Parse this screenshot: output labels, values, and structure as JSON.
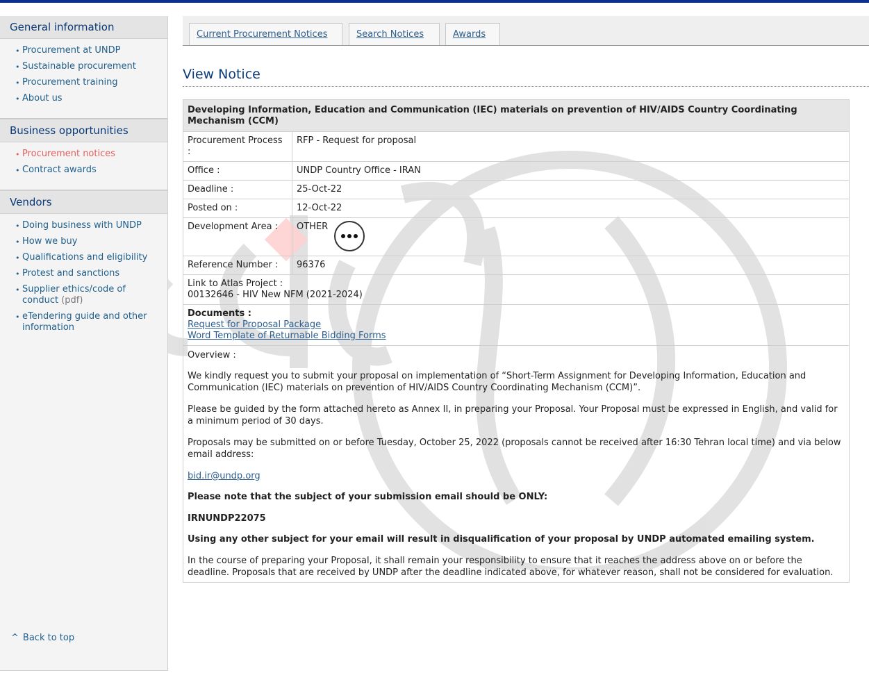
{
  "sidebar": {
    "sections": [
      {
        "title": "General information",
        "items": [
          {
            "label": "Procurement at UNDP"
          },
          {
            "label": "Sustainable procurement"
          },
          {
            "label": "Procurement training"
          },
          {
            "label": "About us"
          }
        ]
      },
      {
        "title": "Business opportunities",
        "items": [
          {
            "label": "Procurement notices",
            "active": true
          },
          {
            "label": "Contract awards"
          }
        ]
      },
      {
        "title": "Vendors",
        "items": [
          {
            "label": "Doing business with UNDP"
          },
          {
            "label": "How we buy"
          },
          {
            "label": "Qualifications and eligibility"
          },
          {
            "label": "Protest and sanctions"
          },
          {
            "label": "Supplier ethics/code of conduct",
            "suffix": "(pdf)"
          },
          {
            "label": "eTendering guide and other information"
          }
        ]
      }
    ],
    "back_to_top": "Back to top",
    "back_to_top_icon": "caret-up-icon"
  },
  "tabs": [
    "Current Procurement Notices",
    "Search Notices",
    "Awards"
  ],
  "page_title": "View Notice",
  "notice": {
    "title": "Developing Information, Education and Communication (IEC) materials on prevention of HIV/AIDS Country Coordinating Mechanism (CCM)",
    "fields": {
      "process_label": "Procurement Process :",
      "process_value": "RFP - Request for proposal",
      "office_label": "Office :",
      "office_value": "UNDP Country Office - IRAN",
      "deadline_label": "Deadline :",
      "deadline_value": "25-Oct-22",
      "posted_label": "Posted on :",
      "posted_value": "12-Oct-22",
      "area_label": "Development Area :",
      "area_value": "OTHER",
      "ref_label": "Reference Number :",
      "ref_value": "96376"
    },
    "atlas_label": "Link to Atlas Project :",
    "atlas_value": "00132646 - HIV New NFM (2021-2024)",
    "documents_label": "Documents :",
    "documents": [
      "Request for Proposal Package",
      "Word Template of Returnable Bidding Forms"
    ],
    "overview_label": "Overview :",
    "overview": {
      "p1": "We kindly request you to submit your proposal on implementation of “Short-Term Assignment for Developing Information, Education and Communication (IEC) materials on prevention of HIV/AIDS Country Coordinating Mechanism (CCM)”.",
      "p2": "Please be guided by the form attached hereto as Annex II, in preparing your Proposal. Your Proposal must be expressed in English, and valid for a minimum period of 30 days.",
      "p3": "Proposals may be submitted on or before Tuesday, October 25, 2022 (proposals cannot be received after 16:30 Tehran local time) and via below email address:",
      "email": "bid.ir@undp.org",
      "p4": "Please note that the subject of your submission email should be ONLY:",
      "subject": "IRNUNDP22075",
      "p5": "Using any other subject for your email will result in disqualification of your proposal by UNDP automated emailing system.",
      "p6": "In the course of preparing your Proposal, it shall remain your responsibility to ensure that it reaches the address above on or before the deadline. Proposals that are received by UNDP after the deadline indicated above, for whatever reason, shall not be considered for evaluation."
    }
  },
  "more_button_icon": "ellipsis-icon",
  "colors": {
    "top_bar": "#0a2f8f",
    "heading": "#0a3a78",
    "link": "#2c5f8f",
    "active_link": "#e06060"
  }
}
